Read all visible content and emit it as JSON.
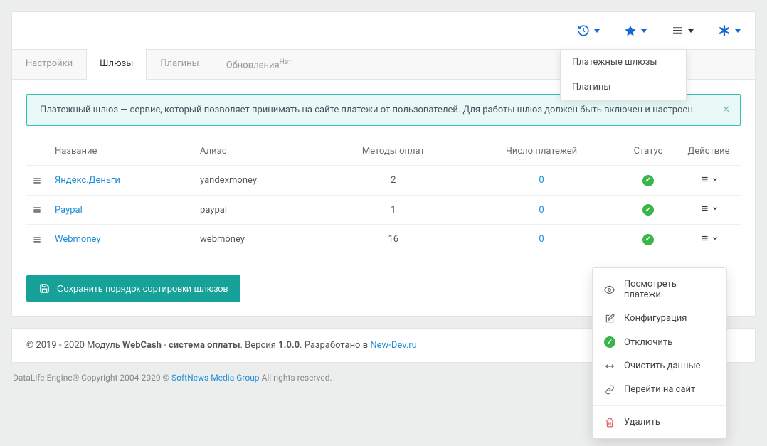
{
  "topbar_dropdown": {
    "items": [
      "Платежные шлюзы",
      "Плагины"
    ]
  },
  "tabs": [
    {
      "label": "Настройки",
      "active": false
    },
    {
      "label": "Шлюзы",
      "active": true
    },
    {
      "label": "Плагины",
      "active": false
    },
    {
      "label": "Обновления",
      "sup": "Нет",
      "active": false
    }
  ],
  "alert": {
    "text": "Платежный шлюз — сервис, который позволяет принимать на сайте платежи от пользователей. Для работы шлюз должен быть включен и настроен."
  },
  "table": {
    "headers": {
      "name": "Название",
      "alias": "Алиас",
      "methods": "Методы оплат",
      "payments": "Число платежей",
      "status": "Статус",
      "action": "Действие"
    },
    "rows": [
      {
        "name": "Яндекс.Деньги",
        "alias": "yandexmoney",
        "methods": "2",
        "payments": "0"
      },
      {
        "name": "Paypal",
        "alias": "paypal",
        "methods": "1",
        "payments": "0"
      },
      {
        "name": "Webmoney",
        "alias": "webmoney",
        "methods": "16",
        "payments": "0"
      }
    ]
  },
  "save_button": "Сохранить порядок сортировки шлюзов",
  "context_menu": {
    "view": "Посмотреть платежи",
    "config": "Конфигурация",
    "disable": "Отключить",
    "clear": "Очистить данные",
    "goto": "Перейти на сайт",
    "delete": "Удалить"
  },
  "footer": {
    "left": "© 2019 - 2020 Модуль ",
    "bold1": "WebCash",
    "mid1": " - ",
    "bold2": "система оплаты",
    "mid2": ". Версия ",
    "bold3": "1.0.0",
    "mid3": ". Разработано в ",
    "link": "New-Dev.ru"
  },
  "page_footer": {
    "left": "DataLife Engine® Copyright 2004-2020 © ",
    "link": "SoftNews Media Group",
    "right": " All rights reserved."
  }
}
